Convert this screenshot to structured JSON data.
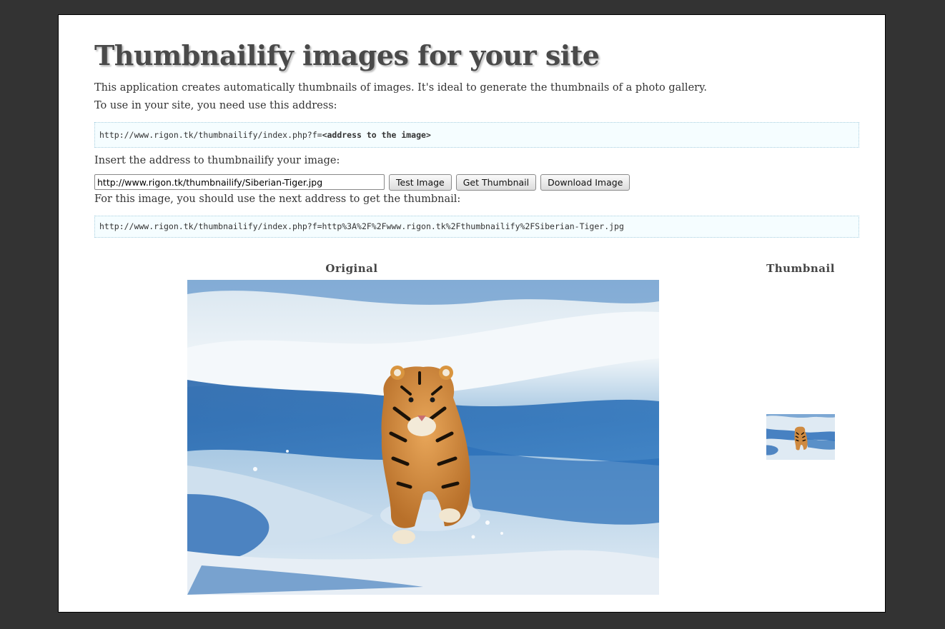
{
  "header": {
    "title": "Thumbnailify images for your site"
  },
  "intro": {
    "description": "This application creates automatically thumbnails of images. It's ideal to generate the thumbnails of a photo gallery.",
    "usage_label": "To use in your site, you need use this address:",
    "usage_url_prefix": "http://www.rigon.tk/thumbnailify/index.php?f=",
    "usage_url_placeholder": "<address to the image>"
  },
  "form": {
    "insert_label": "Insert the address to thumbnailify your image:",
    "url_value": "http://www.rigon.tk/thumbnailify/Siberian-Tiger.jpg",
    "test_button": "Test Image",
    "get_button": "Get Thumbnail",
    "download_button": "Download Image"
  },
  "result": {
    "label": "For this image, you should use the next address to get the thumbnail:",
    "thumbnail_url": "http://www.rigon.tk/thumbnailify/index.php?f=http%3A%2F%2Fwww.rigon.tk%2Fthumbnailify%2FSiberian-Tiger.jpg"
  },
  "preview": {
    "original_label": "Original",
    "thumbnail_label": "Thumbnail"
  },
  "colors": {
    "background": "#333333",
    "page": "#ffffff",
    "code_box": "#f5fdff"
  }
}
